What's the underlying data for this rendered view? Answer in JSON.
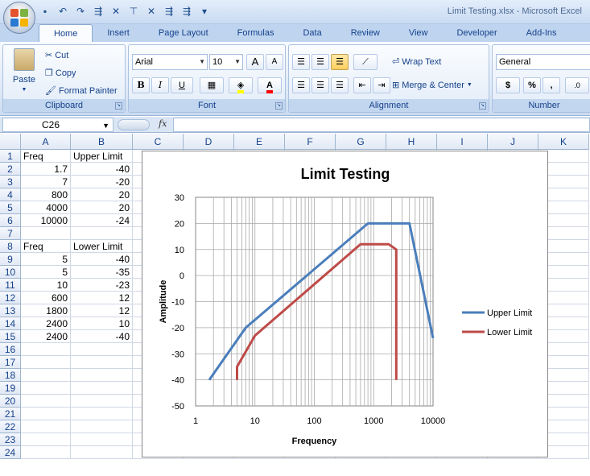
{
  "window": {
    "title": "Limit Testing.xlsx - Microsoft Excel"
  },
  "qat_icons": [
    "save-icon",
    "undo-icon",
    "redo-icon",
    "macro-icon-1",
    "macro-icon-2",
    "macro-icon-3",
    "macro-icon-4",
    "macro-icon-5",
    "macro-icon-6",
    "customize-dropdown-icon"
  ],
  "tabs": [
    "Home",
    "Insert",
    "Page Layout",
    "Formulas",
    "Data",
    "Review",
    "View",
    "Developer",
    "Add-Ins"
  ],
  "active_tab": "Home",
  "ribbon": {
    "clipboard": {
      "label": "Clipboard",
      "paste": "Paste",
      "cut": "Cut",
      "copy": "Copy",
      "format_painter": "Format Painter"
    },
    "font": {
      "label": "Font",
      "name": "Arial",
      "size": "10",
      "bold": "B",
      "italic": "I",
      "underline": "U",
      "grow": "A",
      "shrink": "A",
      "font_color": "A"
    },
    "alignment": {
      "label": "Alignment",
      "wrap_text": "Wrap Text",
      "merge_center": "Merge & Center"
    },
    "number": {
      "label": "Number",
      "format": "General",
      "currency": "$",
      "percent": "%",
      "comma": ",",
      "increase_decimal": ".0"
    }
  },
  "formula_bar": {
    "name_box": "C26",
    "fx": "fx",
    "formula": ""
  },
  "columns": [
    "A",
    "B",
    "C",
    "D",
    "E",
    "F",
    "G",
    "H",
    "I",
    "J",
    "K"
  ],
  "rows": [
    "1",
    "2",
    "3",
    "4",
    "5",
    "6",
    "7",
    "8",
    "9",
    "10",
    "11",
    "12",
    "13",
    "14",
    "15",
    "16",
    "17",
    "18",
    "19",
    "20",
    "21",
    "22",
    "23",
    "24"
  ],
  "cells": {
    "A1": "Freq",
    "B1": "Upper Limit",
    "A2": "1.7",
    "B2": "-40",
    "A3": "7",
    "B3": "-20",
    "A4": "800",
    "B4": "20",
    "A5": "4000",
    "B5": "20",
    "A6": "10000",
    "B6": "-24",
    "A8": "Freq",
    "B8": "Lower Limit",
    "A9": "5",
    "B9": "-40",
    "A10": "5",
    "B10": "-35",
    "A11": "10",
    "B11": "-23",
    "A12": "600",
    "B12": "12",
    "A13": "1800",
    "B13": "12",
    "A14": "2400",
    "B14": "10",
    "A15": "2400",
    "B15": "-40"
  },
  "chart_data": {
    "type": "scatter",
    "title": "Limit Testing",
    "xlabel": "Frequency",
    "ylabel": "Amplitude",
    "x_scale": "log",
    "xlim": [
      1,
      10000
    ],
    "ylim": [
      -50,
      30
    ],
    "x_ticks": [
      "1",
      "10",
      "100",
      "1000",
      "10000"
    ],
    "y_ticks": [
      "30",
      "20",
      "10",
      "0",
      "-10",
      "-20",
      "-30",
      "-40",
      "-50"
    ],
    "grid": true,
    "legend": "right",
    "series": [
      {
        "name": "Upper Limit",
        "color": "#4a7ebb",
        "x": [
          1.7,
          7,
          800,
          4000,
          10000
        ],
        "y": [
          -40,
          -20,
          20,
          20,
          -24
        ]
      },
      {
        "name": "Lower Limit",
        "color": "#be4b48",
        "x": [
          5,
          5,
          10,
          600,
          1800,
          2400,
          2400
        ],
        "y": [
          -40,
          -35,
          -23,
          12,
          12,
          10,
          -40
        ]
      }
    ]
  }
}
